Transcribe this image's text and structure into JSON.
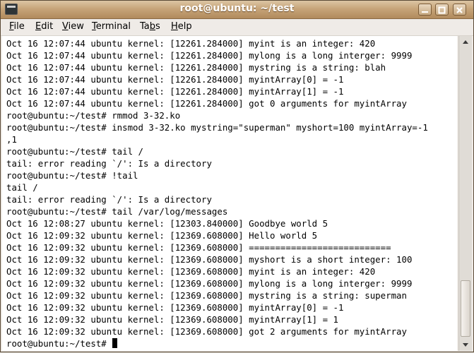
{
  "window": {
    "title": "root@ubuntu: ~/test",
    "icons": {
      "app": "terminal-icon",
      "minimize": "minimize-icon",
      "maximize": "maximize-icon",
      "close": "close-icon"
    }
  },
  "menu": [
    {
      "label": "File",
      "underline": "F",
      "rest": "ile"
    },
    {
      "label": "Edit",
      "underline": "E",
      "rest": "dit"
    },
    {
      "label": "View",
      "underline": "V",
      "rest": "iew"
    },
    {
      "label": "Terminal",
      "underline": "T",
      "rest": "erminal"
    },
    {
      "label": "Tabs",
      "pre": "Ta",
      "underline": "b",
      "rest": "s"
    },
    {
      "label": "Help",
      "underline": "H",
      "rest": "elp"
    }
  ],
  "terminal": {
    "lines": [
      "Oct 16 12:07:44 ubuntu kernel: [12261.284000] myint is an integer: 420",
      "Oct 16 12:07:44 ubuntu kernel: [12261.284000] mylong is a long interger: 9999",
      "Oct 16 12:07:44 ubuntu kernel: [12261.284000] mystring is a string: blah",
      "Oct 16 12:07:44 ubuntu kernel: [12261.284000] myintArray[0] = -1",
      "Oct 16 12:07:44 ubuntu kernel: [12261.284000] myintArray[1] = -1",
      "Oct 16 12:07:44 ubuntu kernel: [12261.284000] got 0 arguments for myintArray",
      "root@ubuntu:~/test# rmmod 3-32.ko",
      "root@ubuntu:~/test# insmod 3-32.ko mystring=\"superman\" myshort=100 myintArray=-1",
      ",1",
      "root@ubuntu:~/test# tail /",
      "tail: error reading `/': Is a directory",
      "root@ubuntu:~/test# !tail",
      "tail /",
      "tail: error reading `/': Is a directory",
      "root@ubuntu:~/test# tail /var/log/messages",
      "Oct 16 12:08:27 ubuntu kernel: [12303.840000] Goodbye world 5",
      "Oct 16 12:09:32 ubuntu kernel: [12369.608000] Hello world 5",
      "Oct 16 12:09:32 ubuntu kernel: [12369.608000] ===========================",
      "Oct 16 12:09:32 ubuntu kernel: [12369.608000] myshort is a short integer: 100",
      "Oct 16 12:09:32 ubuntu kernel: [12369.608000] myint is an integer: 420",
      "Oct 16 12:09:32 ubuntu kernel: [12369.608000] mylong is a long interger: 9999",
      "Oct 16 12:09:32 ubuntu kernel: [12369.608000] mystring is a string: superman",
      "Oct 16 12:09:32 ubuntu kernel: [12369.608000] myintArray[0] = -1",
      "Oct 16 12:09:32 ubuntu kernel: [12369.608000] myintArray[1] = 1",
      "Oct 16 12:09:32 ubuntu kernel: [12369.608000] got 2 arguments for myintArray"
    ],
    "prompt": "root@ubuntu:~/test# "
  },
  "scrollbar": {
    "up_icon": "arrow-up-icon",
    "down_icon": "arrow-down-icon",
    "position_fraction": 1.0
  },
  "colors": {
    "titlebar": "#c7a57a",
    "title_text": "#ffffff",
    "terminal_bg": "#ffffff",
    "terminal_fg": "#000000"
  }
}
